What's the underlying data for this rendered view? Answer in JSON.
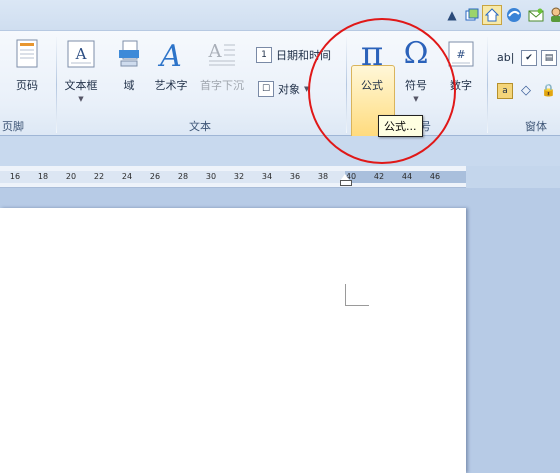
{
  "quick_access": {
    "icons": [
      "chevron-up-icon",
      "window-icon",
      "home-icon",
      "browser-icon",
      "envelope-icon",
      "user-icon"
    ]
  },
  "ribbon": {
    "groups": {
      "header_footer": "页脚",
      "text": "文本",
      "symbols_partial": "号",
      "controls": "窗体"
    },
    "buttons": {
      "page_number": "页码",
      "text_box": "文本框",
      "field": "域",
      "word_art": "艺术字",
      "drop_cap": "首字下沉",
      "date_time": "日期和时间",
      "object": "对象",
      "equation": "公式",
      "symbol": "符号",
      "number": "数字",
      "ab_control": "ab|"
    },
    "equation_symbol": "π",
    "symbol_glyph": "Ω",
    "textbox_glyph": "A",
    "wordart_glyph": "A",
    "dropcap_glyph": "A"
  },
  "tooltip": {
    "text": "公式..."
  },
  "ruler": {
    "ticks": [
      "16",
      "18",
      "20",
      "22",
      "24",
      "26",
      "28",
      "30",
      "32",
      "34",
      "36",
      "38",
      "40",
      "42",
      "44",
      "46"
    ]
  },
  "colors": {
    "annotation": "#e01818",
    "highlight": "#ffe7a2",
    "ribbon_bg": "#e9f0f9"
  }
}
